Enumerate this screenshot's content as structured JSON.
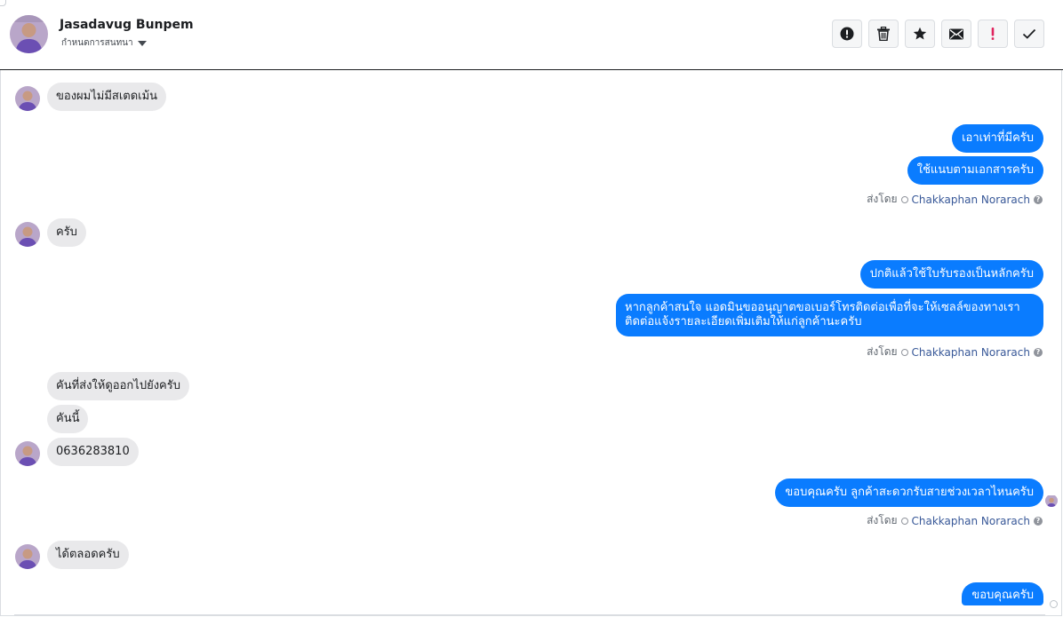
{
  "header": {
    "contact_name": "Jasadavug Bunpem",
    "conversation_status": "กำหนดการสนทนา",
    "actions": [
      {
        "name": "mark-spam-button",
        "icon": "alert-circle-icon"
      },
      {
        "name": "delete-button",
        "icon": "trash-icon"
      },
      {
        "name": "star-button",
        "icon": "star-icon"
      },
      {
        "name": "mark-unread-button",
        "icon": "envelope-icon"
      },
      {
        "name": "follow-up-button",
        "icon": "exclamation-icon"
      },
      {
        "name": "mark-done-button",
        "icon": "check-icon"
      }
    ]
  },
  "messages": {
    "in1": "ของผมไม่มีสเตดเม้น",
    "out1a": "เอาเท่าที่มีครับ",
    "out1b": "ใช้แนบตามเอกสารครับ",
    "sent_by_label": "ส่งโดย",
    "agent_name": "Chakkaphan Norarach",
    "in2": "ครับ",
    "out2a": "ปกติแล้วใช้ใบรับรองเป็นหลักครับ",
    "out2b_line1": "หากลูกค้าสนใจ แอดมินขออนุญาตขอเบอร์โทรติดต่อเพื่อที่จะให้เซลล์ของทางเรา",
    "out2b_line2": "ติดต่อแจ้งรายละเอียดเพิ่มเติมให้แก่ลูกค้านะครับ",
    "in3a": "คันที่ส่งให้ดูออกไปยังครับ",
    "in3b": "คันนี้",
    "in3c": "0636283810",
    "out3": "ขอบคุณครับ ลูกค้าสะดวกรับสายช่วงเวลาไหนครับ",
    "in4": "ได้ตลอดครับ",
    "out4": "ขอบคุณครับ"
  },
  "colors": {
    "outgoing": "#0a7cff",
    "incoming": "#e9e9eb",
    "link": "#385898"
  }
}
